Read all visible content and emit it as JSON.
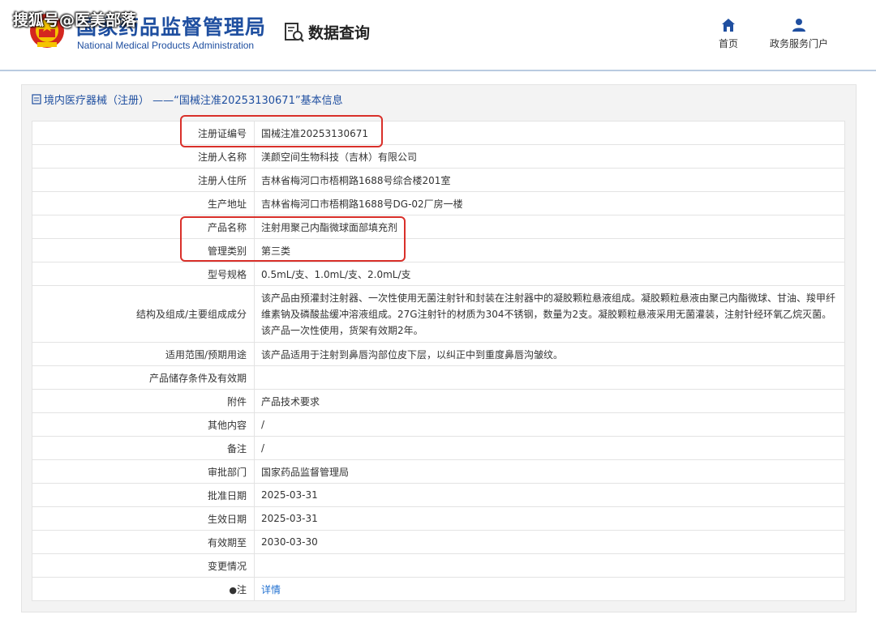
{
  "watermark": "搜狐号@医美部落",
  "header": {
    "org_name": "国家药品监督管理局",
    "org_en": "National Medical Products Administration",
    "query_label": "数据查询",
    "nav": [
      {
        "label": "首页",
        "icon": "home-icon"
      },
      {
        "label": "政务服务门户",
        "icon": "user-icon"
      }
    ]
  },
  "panel": {
    "title": "境内医疗器械（注册） ——“国械注准20253130671”基本信息"
  },
  "rows": [
    {
      "k": "注册证编号",
      "v": "国械注准20253130671"
    },
    {
      "k": "注册人名称",
      "v": "渼颜空间生物科技（吉林）有限公司"
    },
    {
      "k": "注册人住所",
      "v": "吉林省梅河口市梧桐路1688号综合楼201室"
    },
    {
      "k": "生产地址",
      "v": "吉林省梅河口市梧桐路1688号DG-02厂房一楼"
    },
    {
      "k": "产品名称",
      "v": "注射用聚己内酯微球面部填充剂"
    },
    {
      "k": "管理类别",
      "v": "第三类"
    },
    {
      "k": "型号规格",
      "v": "0.5mL/支、1.0mL/支、2.0mL/支"
    },
    {
      "k": "结构及组成/主要组成成分",
      "v": "该产品由预灌封注射器、一次性使用无菌注射针和封装在注射器中的凝胶颗粒悬液组成。凝胶颗粒悬液由聚己内酯微球、甘油、羧甲纤维素钠及磷酸盐缓冲溶液组成。27G注射针的材质为304不锈钢，数量为2支。凝胶颗粒悬液采用无菌灌装，注射针经环氧乙烷灭菌。该产品一次性使用，货架有效期2年。"
    },
    {
      "k": "适用范围/预期用途",
      "v": "该产品适用于注射到鼻唇沟部位皮下层，以纠正中到重度鼻唇沟皱纹。"
    },
    {
      "k": "产品储存条件及有效期",
      "v": ""
    },
    {
      "k": "附件",
      "v": "产品技术要求"
    },
    {
      "k": "其他内容",
      "v": "/"
    },
    {
      "k": "备注",
      "v": "/"
    },
    {
      "k": "审批部门",
      "v": "国家药品监督管理局"
    },
    {
      "k": "批准日期",
      "v": "2025-03-31"
    },
    {
      "k": "生效日期",
      "v": "2025-03-31"
    },
    {
      "k": "有效期至",
      "v": "2030-03-30"
    },
    {
      "k": "变更情况",
      "v": ""
    },
    {
      "k": "注",
      "v": "详情"
    }
  ]
}
